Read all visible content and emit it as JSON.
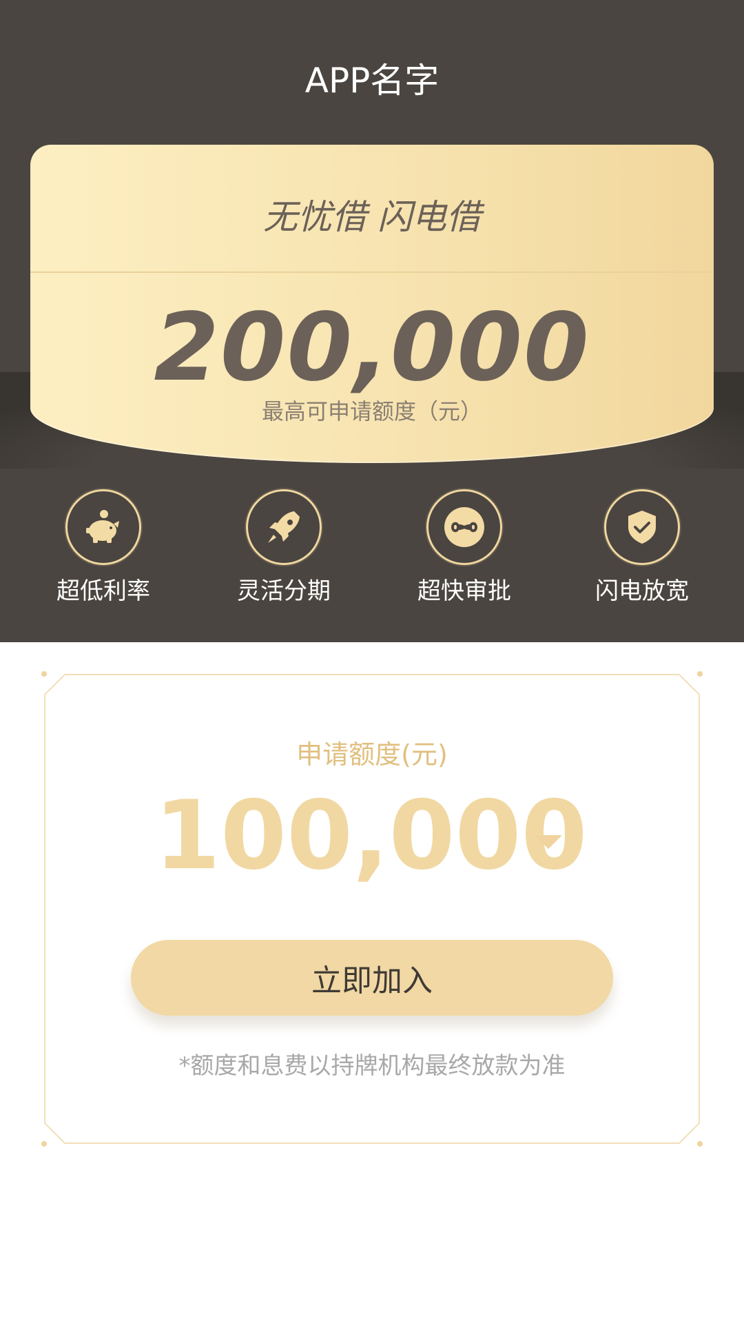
{
  "app": {
    "title": "APP名字"
  },
  "hero": {
    "slogan": "无忧借 闪电借",
    "max_amount": "200,000",
    "caption": "最高可申请额度（元）"
  },
  "features": [
    {
      "label": "超低利率",
      "icon": "piggy-bank-icon"
    },
    {
      "label": "灵活分期",
      "icon": "rocket-icon"
    },
    {
      "label": "超快审批",
      "icon": "infinity-icon"
    },
    {
      "label": "闪电放宽",
      "icon": "shield-check-icon"
    }
  ],
  "apply": {
    "title": "申请额度(元)",
    "amount": "100,000",
    "button_label": "立即加入",
    "note": "*额度和息费以持牌机构最终放款为准"
  },
  "colors": {
    "header_bg": "#4a4540",
    "gold": "#f1d8a2",
    "text_dark": "#6b6158"
  }
}
